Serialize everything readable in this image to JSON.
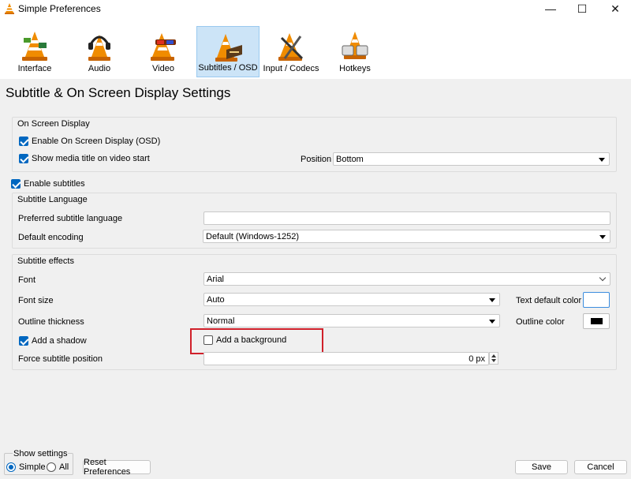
{
  "window": {
    "title": "Simple Preferences",
    "minimize_glyph": "—",
    "maximize_glyph": "☐",
    "close_glyph": "✕"
  },
  "tabs": [
    {
      "label": "Interface",
      "icon": "cone-interface-icon"
    },
    {
      "label": "Audio",
      "icon": "cone-headphones-icon"
    },
    {
      "label": "Video",
      "icon": "cone-glasses-icon"
    },
    {
      "label": "Subtitles / OSD",
      "icon": "cone-subtitles-icon",
      "selected": true
    },
    {
      "label": "Input / Codecs",
      "icon": "cone-tools-icon"
    },
    {
      "label": "Hotkeys",
      "icon": "cone-hotkeys-icon"
    }
  ],
  "page_title": "Subtitle & On Screen Display Settings",
  "osd": {
    "group_title": "On Screen Display",
    "enable_osd": {
      "label": "Enable On Screen Display (OSD)",
      "checked": true
    },
    "show_media_title": {
      "label": "Show media title on video start",
      "checked": true
    },
    "position_label": "Position",
    "position_value": "Bottom"
  },
  "enable_subtitles": {
    "label": "Enable subtitles",
    "checked": true
  },
  "subtitle_language": {
    "group_title": "Subtitle Language",
    "preferred_label": "Preferred subtitle language",
    "preferred_value": "",
    "encoding_label": "Default encoding",
    "encoding_value": "Default (Windows-1252)"
  },
  "effects": {
    "group_title": "Subtitle effects",
    "font_label": "Font",
    "font_value": "Arial",
    "font_size_label": "Font size",
    "font_size_value": "Auto",
    "text_color_label": "Text default color",
    "text_color": "#ffffff",
    "outline_thickness_label": "Outline thickness",
    "outline_thickness_value": "Normal",
    "outline_color_label": "Outline color",
    "outline_color": "#000000",
    "add_shadow": {
      "label": "Add a shadow",
      "checked": true
    },
    "add_background": {
      "label": "Add a background",
      "checked": false
    },
    "force_position_label": "Force subtitle position",
    "force_position_value": "0 px"
  },
  "show_settings": {
    "label": "Show settings",
    "simple": "Simple",
    "all": "All",
    "selected": "Simple"
  },
  "buttons": {
    "reset": "Reset Preferences",
    "save": "Save",
    "cancel": "Cancel"
  },
  "colors": {
    "highlight": "#d0202a",
    "accent": "#0067c0",
    "selected_tab": "#cce4f7"
  }
}
